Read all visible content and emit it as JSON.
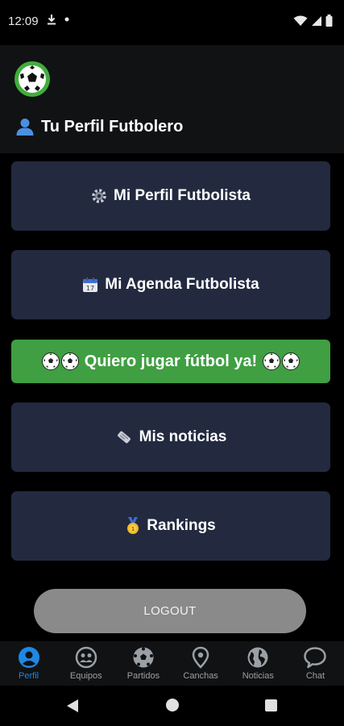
{
  "status_bar": {
    "time": "12:09",
    "icons": [
      "download-icon",
      "dot-icon",
      "wifi-icon",
      "cell-signal-icon",
      "battery-icon"
    ]
  },
  "header": {
    "logo_icon": "soccer-ball-logo",
    "title": "Tu Perfil Futbolero",
    "title_icon": "person-icon"
  },
  "menu": {
    "profile": {
      "icon": "gear-icon",
      "label": "Mi Perfil Futbolista"
    },
    "agenda": {
      "icon": "calendar-icon",
      "label": "Mi Agenda Futbolista"
    },
    "play": {
      "icon": "soccer-ball-icon",
      "label": "Quiero jugar fútbol ya!"
    },
    "news": {
      "icon": "newspaper-icon",
      "label": "Mis noticias"
    },
    "rankings": {
      "icon": "medal-icon",
      "label": "Rankings"
    }
  },
  "logout": {
    "label": "LOGOUT"
  },
  "bottom_nav": {
    "items": [
      {
        "label": "Perfil",
        "icon": "person-circle-icon",
        "active": true
      },
      {
        "label": "Equipos",
        "icon": "team-icon",
        "active": false
      },
      {
        "label": "Partidos",
        "icon": "soccer-ball-icon",
        "active": false
      },
      {
        "label": "Canchas",
        "icon": "location-pin-icon",
        "active": false
      },
      {
        "label": "Noticias",
        "icon": "globe-icon",
        "active": false
      },
      {
        "label": "Chat",
        "icon": "chat-bubble-icon",
        "active": false
      }
    ]
  },
  "colors": {
    "card": "#232a40",
    "play_button": "#3f9f42",
    "logout_button": "#8a8a8a",
    "active_tab": "#1e88e5",
    "inactive_tab": "#9aa0a6"
  }
}
